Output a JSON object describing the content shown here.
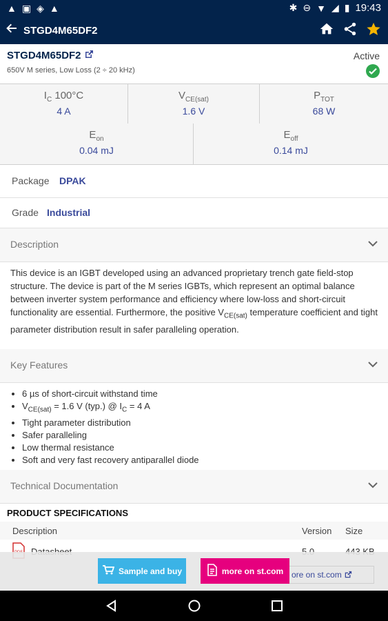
{
  "status_bar": {
    "time": "19:43",
    "left_icons": [
      "warning-icon",
      "image-icon",
      "shield-icon",
      "warning-icon"
    ],
    "right_icons": [
      "bluetooth-icon",
      "do-not-disturb-icon",
      "wifi-icon",
      "signal-icon",
      "battery-icon"
    ]
  },
  "app_bar": {
    "title": "STGD4M65DF2",
    "icons": [
      "back-arrow-icon",
      "home-icon",
      "share-icon",
      "star-icon"
    ]
  },
  "product": {
    "part_number": "STGD4M65DF2",
    "subtitle": "650V M series, Low Loss (2 ÷ 20 kHz)",
    "status": "Active"
  },
  "params_row1": [
    {
      "label": "I",
      "sub": "C",
      "suffix": " 100°C",
      "value": "4 A"
    },
    {
      "label": "V",
      "sub": "CE(sat)",
      "suffix": "",
      "value": "1.6 V"
    },
    {
      "label": "P",
      "sub": "TOT",
      "suffix": "",
      "value": "68 W"
    }
  ],
  "params_row2": [
    {
      "label": "E",
      "sub": "on",
      "value": "0.04 mJ"
    },
    {
      "label": "E",
      "sub": "off",
      "value": "0.14 mJ"
    }
  ],
  "package": {
    "label": "Package",
    "value": "DPAK"
  },
  "grade": {
    "label": "Grade",
    "value": "Industrial"
  },
  "sections": {
    "description": "Description",
    "key_features": "Key Features",
    "technical_documentation": "Technical Documentation"
  },
  "description_text": {
    "part1": "This device is an IGBT developed using an advanced proprietary trench gate field-stop structure. The device is part of the M series IGBTs, which represent an optimal balance between inverter system performance and efficiency where low-loss and short-circuit functionality are essential. Furthermore, the positive V",
    "sub": "CE(sat)",
    "part2": " temperature coefficient and tight parameter distribution result in safer paralleling operation."
  },
  "features": {
    "f1": "6 µs of short-circuit withstand time",
    "f2_a": "V",
    "f2_sub1": "CE(sat)",
    "f2_b": " = 1.6 V (typ.) @ I",
    "f2_sub2": "C",
    "f2_c": " = 4 A",
    "f3": "Tight parameter distribution",
    "f4": "Safer paralleling",
    "f5": "Low thermal resistance",
    "f6": "Soft and very fast recovery antiparallel diode"
  },
  "specs": {
    "title": "PRODUCT SPECIFICATIONS",
    "columns": [
      "Description",
      "Version",
      "Size"
    ],
    "row": {
      "description": "Datasheet",
      "version": "5.0",
      "size": "443 KB"
    }
  },
  "buttons": {
    "sample": "Sample and buy",
    "more": "more on st.com",
    "more_ghost": "ore on st.com"
  },
  "colors": {
    "app_bar": "#03234b",
    "value_text": "#3a4a9b",
    "status_active": "#2fa84f",
    "star": "#f5b400",
    "sample_button": "#3bb3e6",
    "more_button": "#e6007e"
  }
}
